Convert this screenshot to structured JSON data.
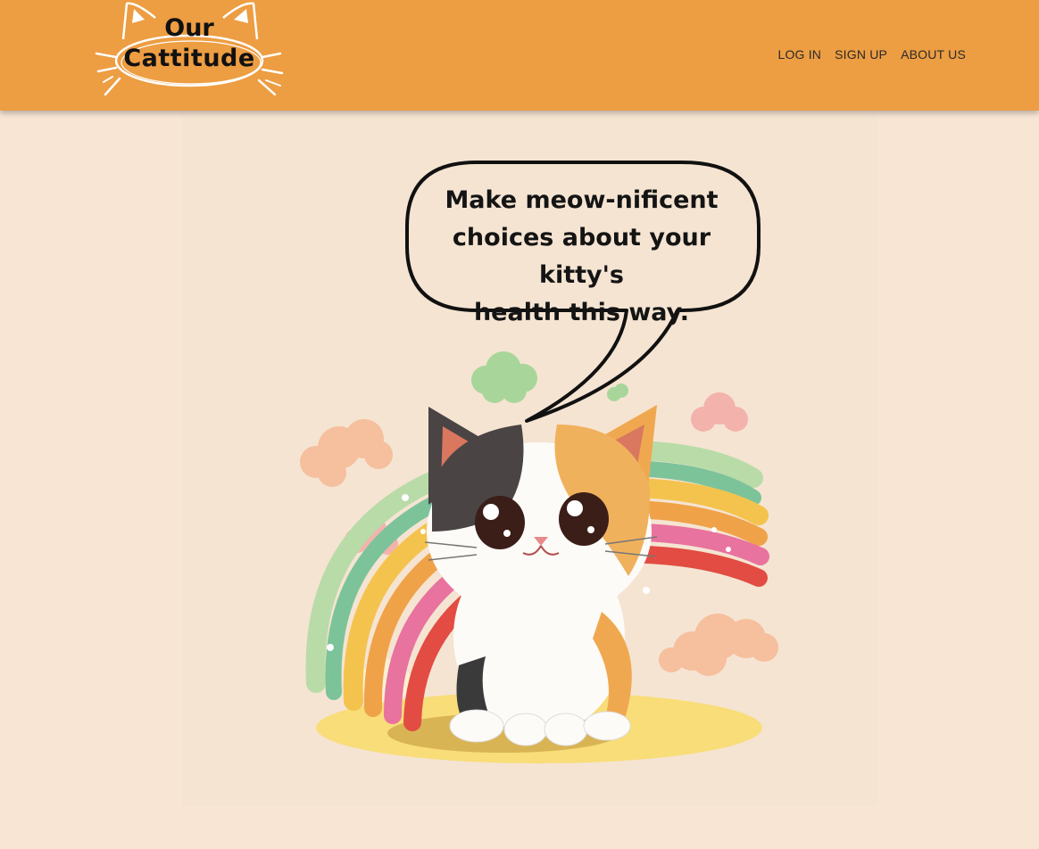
{
  "brand": {
    "logo_line1": "Our",
    "logo_line2": "Cattitude",
    "header_color": "#ed9d42",
    "page_background": "#f8e5d4"
  },
  "nav": {
    "items": [
      {
        "label": "LOG IN"
      },
      {
        "label": "SIGN UP"
      },
      {
        "label": "ABOUT US"
      }
    ]
  },
  "hero": {
    "speech_bubble_text": "Make meow-nificent\nchoices about your kitty's\nhealth this way.",
    "illustration": "calico-kitten-rainbow-icon"
  }
}
